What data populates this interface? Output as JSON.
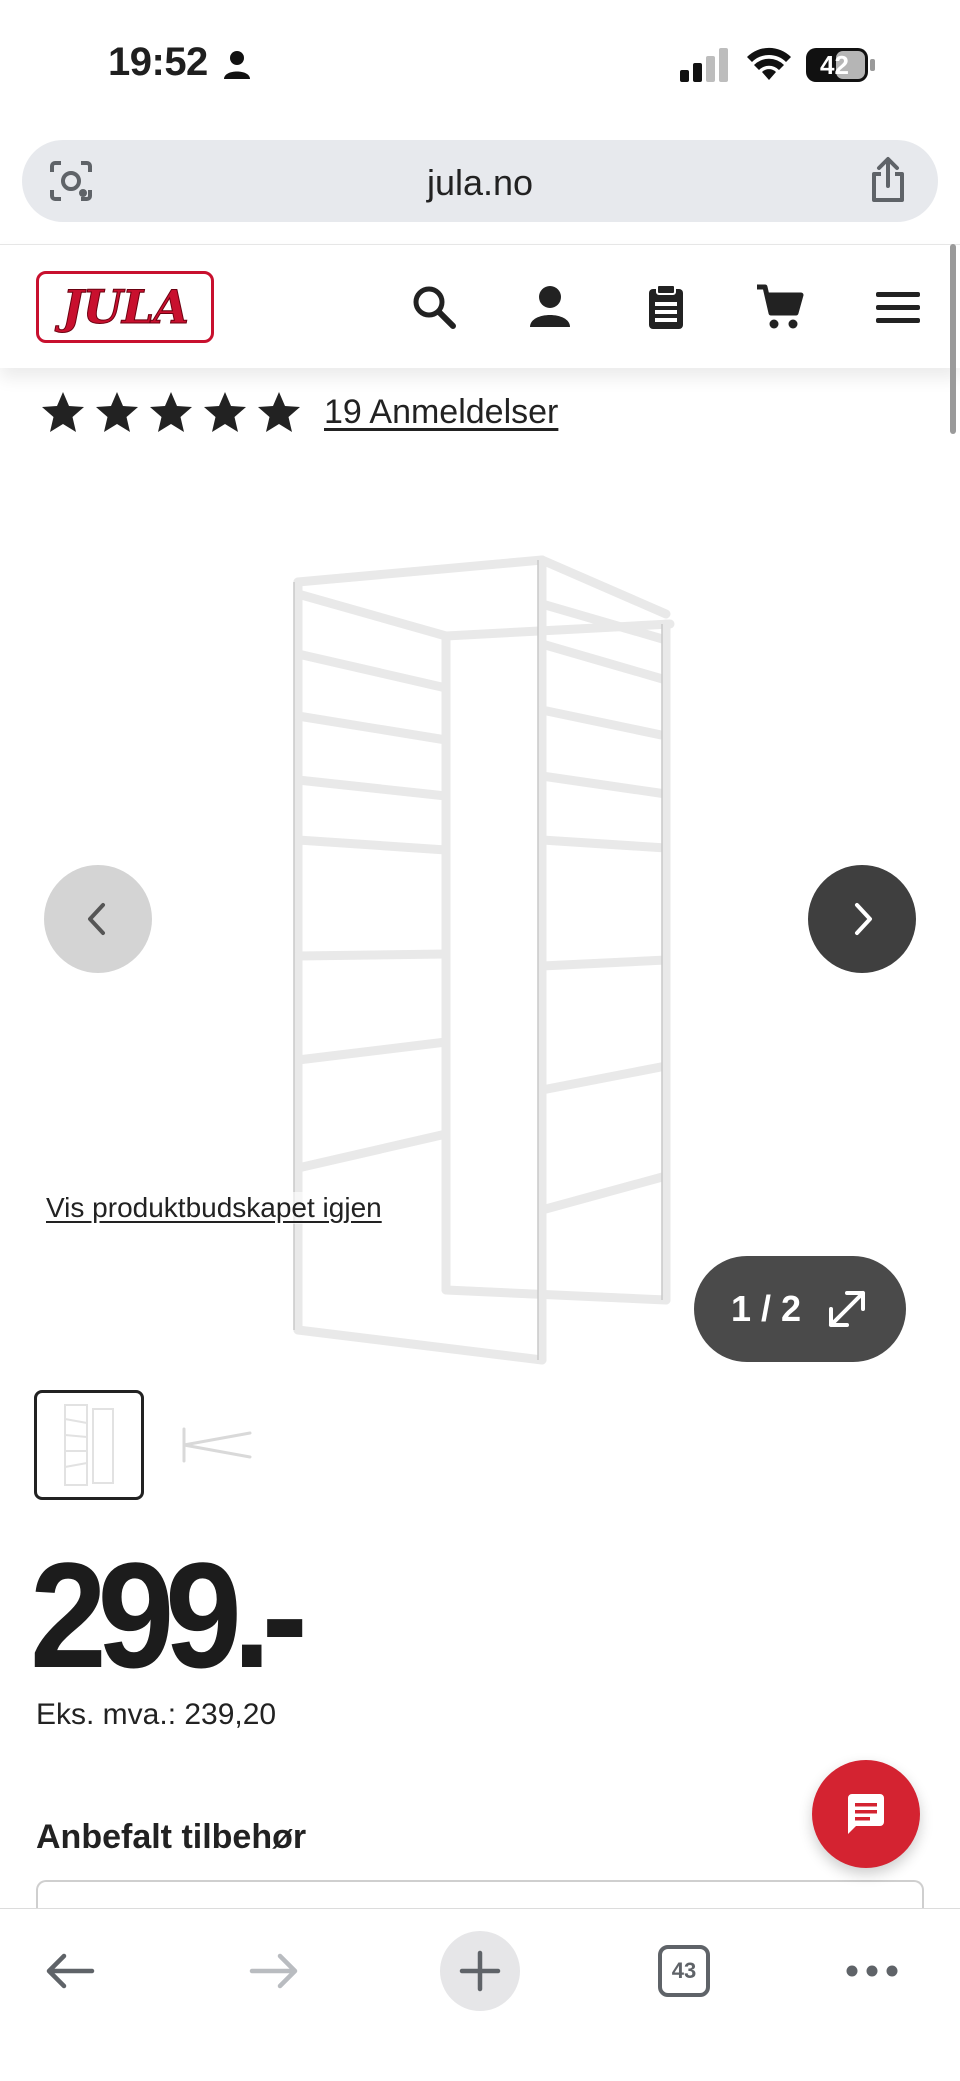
{
  "status_bar": {
    "time": "19:52",
    "battery": "42"
  },
  "browser": {
    "url": "jula.no",
    "tab_count": "43"
  },
  "site_header": {
    "logo_text": "JULA",
    "icons": [
      "search-icon",
      "account-icon",
      "list-icon",
      "cart-icon",
      "menu-icon"
    ]
  },
  "product": {
    "rating_stars": 5,
    "reviews_link": "19 Anmeldelser",
    "gallery": {
      "restore_link": "Vis produktbudskapet igjen",
      "counter": "1 / 2"
    },
    "price": "299.-",
    "ex_vat": "Eks. mva.: 239,20"
  },
  "recommended": {
    "title": "Anbefalt tilbehør"
  },
  "colors": {
    "brand_red": "#c8102e",
    "chat_red": "#d42331",
    "dark_button": "#3f3f3f"
  }
}
